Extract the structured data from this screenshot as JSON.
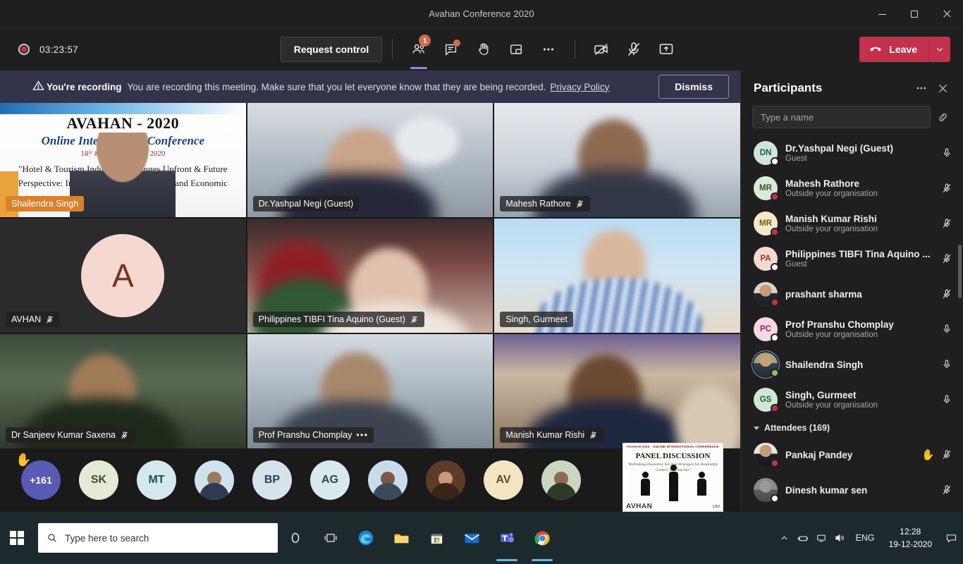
{
  "window": {
    "title": "Avahan Conference 2020",
    "minimize": "minimize-icon",
    "maximize": "restore-icon",
    "close": "close-icon"
  },
  "toolbar": {
    "recording_time": "03:23:57",
    "request_control_label": "Request control",
    "icons": [
      {
        "name": "people-icon",
        "badge": "1",
        "active": true
      },
      {
        "name": "chat-icon",
        "badge": "",
        "active": false
      },
      {
        "name": "raise-hand-icon",
        "badge": "",
        "active": false
      },
      {
        "name": "breakout-rooms-icon",
        "badge": "",
        "active": false
      },
      {
        "name": "more-options-icon",
        "badge": "",
        "active": false
      }
    ],
    "camera_icon": "camera-off-icon",
    "mic_icon": "microphone-off-icon",
    "share_icon": "share-screen-icon",
    "leave_label": "Leave",
    "leave_caret": "chevron-down-icon"
  },
  "banner": {
    "warning_icon": "warning-icon",
    "strong": "You're recording",
    "text": "You are recording this meeting. Make sure that you let everyone know that they are being recorded.",
    "link": "Privacy Policy",
    "dismiss_label": "Dismiss"
  },
  "stage": {
    "tiles": [
      {
        "label": "Shailendra Singh",
        "muted": false,
        "highlight": true,
        "kind": "poster",
        "poster": {
          "line1": "AVAHAN - 2020",
          "line2": "Online International Conference",
          "line3": "18ᵗʰ & 19ᵗʰ December 2020",
          "line4": "\"Hotel & Tourism Industry Challenges Upfront & Future Perspective: Innovation, Entrepreneurship and Economic Policy\"."
        }
      },
      {
        "label": "Dr.Yashpal Negi (Guest)",
        "muted": false,
        "kind": "video",
        "style": "vid-b"
      },
      {
        "label": "Mahesh Rathore",
        "muted": true,
        "kind": "video",
        "style": "vid-c"
      },
      {
        "label": "AVHAN",
        "muted": true,
        "kind": "avatar",
        "initial": "A"
      },
      {
        "label": "Philippines TIBFI Tina Aquino (Guest)",
        "muted": true,
        "kind": "video",
        "style": "vid-d"
      },
      {
        "label": "Singh, Gurmeet",
        "muted": false,
        "kind": "video",
        "style": "vid-e"
      },
      {
        "label": "Dr Sanjeev Kumar Saxena",
        "muted": true,
        "kind": "video",
        "style": "vid-f"
      },
      {
        "label": "Prof Pranshu Chomplay",
        "muted": false,
        "more": "•••",
        "kind": "video",
        "style": "vid-g"
      },
      {
        "label": "Manish Kumar Rishi",
        "muted": true,
        "kind": "video",
        "style": "vid-h"
      }
    ]
  },
  "filmstrip": {
    "overflow_count": "+161",
    "overflow_hand": "✋",
    "items": [
      {
        "initials": "SK",
        "bg": "#e4ead4",
        "fg": "#3c4a2b",
        "photo": false
      },
      {
        "initials": "MT",
        "bg": "#d4e9ee",
        "fg": "#274b54",
        "photo": false
      },
      {
        "initials": "",
        "bg": "#cfe3ef",
        "fg": "#274b54",
        "photo": true
      },
      {
        "initials": "BP",
        "bg": "#d7e3ea",
        "fg": "#2b4450",
        "photo": false
      },
      {
        "initials": "AG",
        "bg": "#d7e9ec",
        "fg": "#26494f",
        "photo": false
      },
      {
        "initials": "",
        "bg": "#c9dceb",
        "fg": "#27404f",
        "photo": true
      },
      {
        "initials": "",
        "bg": "#5c3c28",
        "fg": "#ffffff",
        "photo": true
      },
      {
        "initials": "AV",
        "bg": "#f4e4c3",
        "fg": "#6a4a1c",
        "photo": false
      },
      {
        "initials": "",
        "bg": "#c9d6c2",
        "fg": "#2b3a28",
        "photo": true
      }
    ]
  },
  "panel_slide": {
    "header": "AVAHAN 2020  ·  ONLINE INTERNATIONAL CONFERENCE",
    "title": "PANEL DISCUSSION",
    "subtitle": "\"Rethinking Innovative Survival Strategies for Hospitality, Cookery and Tourism\"",
    "brand": "AVHAN",
    "logos": "LPU"
  },
  "participants": {
    "title": "Participants",
    "more_icon": "more-options-icon",
    "close_icon": "close-icon",
    "search_placeholder": "Type a name",
    "share_link_icon": "copy-join-link-icon",
    "people": [
      {
        "initials": "DN",
        "name": "Dr.Yashpal Negi (Guest)",
        "sub": "Guest",
        "bg": "#cfe4da",
        "fg": "#1f5c47",
        "presence": "off",
        "mic": "mic-on-icon",
        "photo": false,
        "ring": false,
        "hand": ""
      },
      {
        "initials": "MR",
        "name": "Mahesh Rathore",
        "sub": "Outside your organisation",
        "bg": "#dce9d5",
        "fg": "#33512a",
        "presence": "busy",
        "mic": "mic-off-icon",
        "photo": false,
        "ring": false,
        "hand": ""
      },
      {
        "initials": "MR",
        "name": "Manish Kumar Rishi",
        "sub": "Outside your organisation",
        "bg": "#f6e9c8",
        "fg": "#7a5a17",
        "presence": "busy",
        "mic": "mic-off-icon",
        "photo": false,
        "ring": false,
        "hand": ""
      },
      {
        "initials": "PA",
        "name": "Philippines TIBFI Tina Aquino ...",
        "sub": "Guest",
        "bg": "#f5d9d1",
        "fg": "#8c3a28",
        "presence": "off",
        "mic": "mic-off-icon",
        "photo": false,
        "ring": false,
        "hand": ""
      },
      {
        "initials": "",
        "name": "prashant sharma",
        "sub": "",
        "bg": "#8f7a62",
        "fg": "#ffffff",
        "presence": "busy",
        "mic": "mic-off-icon",
        "photo": true,
        "ring": false,
        "hand": ""
      },
      {
        "initials": "PC",
        "name": "Prof Pranshu Chomplay",
        "sub": "Outside your organisation",
        "bg": "#f8d7e3",
        "fg": "#8f2a55",
        "presence": "off",
        "mic": "mic-on-icon",
        "photo": false,
        "ring": false,
        "hand": ""
      },
      {
        "initials": "",
        "name": "Shailendra Singh",
        "sub": "",
        "bg": "#7d8a5e",
        "fg": "#ffffff",
        "presence": "avail",
        "mic": "mic-on-icon",
        "photo": true,
        "ring": true,
        "hand": ""
      },
      {
        "initials": "GS",
        "name": "Singh, Gurmeet",
        "sub": "Outside your organisation",
        "bg": "#cfe8d6",
        "fg": "#1f5c3a",
        "presence": "busy",
        "mic": "mic-on-icon",
        "photo": false,
        "ring": false,
        "hand": ""
      }
    ],
    "attendees_header": "Attendees (169)",
    "attendees": [
      {
        "initials": "",
        "name": "Pankaj Pandey",
        "sub": "",
        "bg": "#9c7a5f",
        "fg": "#ffffff",
        "presence": "busy",
        "mic": "mic-off-icon",
        "photo": true,
        "ring": false,
        "hand": "✋"
      },
      {
        "initials": "",
        "name": "Dinesh kumar sen",
        "sub": "",
        "bg": "#6f6f6f",
        "fg": "#ffffff",
        "presence": "off",
        "mic": "mic-off-icon",
        "photo": true,
        "ring": false,
        "hand": ""
      }
    ]
  },
  "taskbar": {
    "start_icon": "windows-start-icon",
    "search_placeholder": "Type here to search",
    "search_icon": "search-icon",
    "apps": [
      {
        "name": "cortana-icon",
        "running": false
      },
      {
        "name": "task-view-icon",
        "running": false
      },
      {
        "name": "microsoft-edge-icon",
        "running": false
      },
      {
        "name": "file-explorer-icon",
        "running": false
      },
      {
        "name": "microsoft-store-icon",
        "running": false
      },
      {
        "name": "mail-icon",
        "running": false
      },
      {
        "name": "microsoft-teams-icon",
        "running": true
      },
      {
        "name": "google-chrome-icon",
        "running": true
      }
    ],
    "tray": {
      "overflow_icon": "show-hidden-icons-icon",
      "power_icon": "battery-icon",
      "network_icon": "network-icon",
      "volume_icon": "volume-icon",
      "language": "ENG",
      "time": "12:28",
      "date": "19-12-2020",
      "action_center_icon": "action-center-icon"
    }
  }
}
